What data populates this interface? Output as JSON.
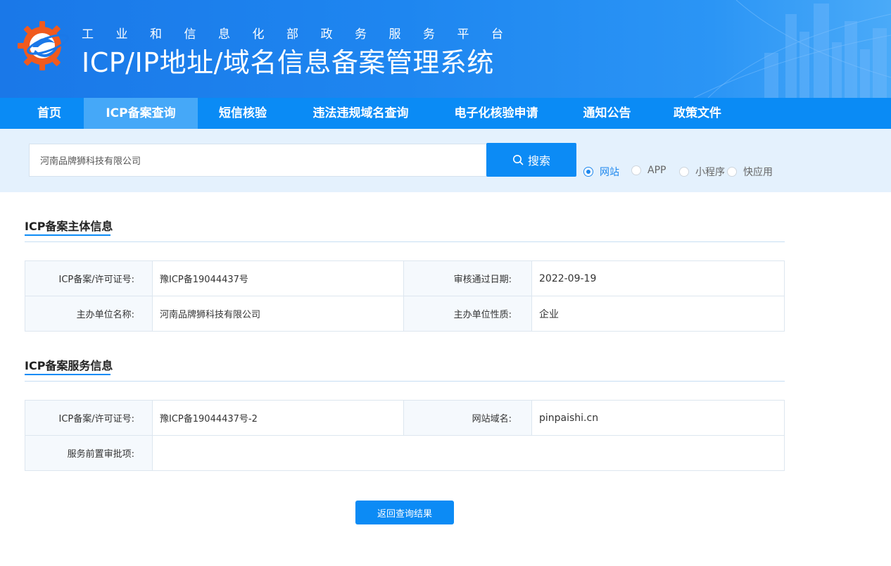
{
  "header": {
    "subtitle": "工业和信息化部政务服务平台",
    "title": "ICP/IP地址/域名信息备案管理系统"
  },
  "nav": {
    "items": [
      {
        "label": "首页"
      },
      {
        "label": "ICP备案查询",
        "active": true
      },
      {
        "label": "短信核验"
      },
      {
        "label": "违法违规域名查询"
      },
      {
        "label": "电子化核验申请"
      },
      {
        "label": "通知公告"
      },
      {
        "label": "政策文件"
      }
    ]
  },
  "search": {
    "value": "河南品牌狮科技有限公司",
    "button_label": "搜索",
    "types": [
      {
        "label": "网站",
        "checked": true
      },
      {
        "label": "APP",
        "checked": false
      },
      {
        "label": "小程序",
        "checked": false
      },
      {
        "label": "快应用",
        "checked": false
      }
    ]
  },
  "subject_section": {
    "title": "ICP备案主体信息",
    "rows": [
      {
        "k1": "ICP备案/许可证号:",
        "v1": "豫ICP备19044437号",
        "k2": "审核通过日期:",
        "v2": "2022-09-19"
      },
      {
        "k1": "主办单位名称:",
        "v1": "河南品牌狮科技有限公司",
        "k2": "主办单位性质:",
        "v2": "企业"
      }
    ]
  },
  "service_section": {
    "title": "ICP备案服务信息",
    "row1": {
      "k1": "ICP备案/许可证号:",
      "v1": "豫ICP备19044437号-2",
      "k2": "网站域名:",
      "v2": "pinpaishi.cn"
    },
    "row2": {
      "k1": "服务前置审批项:",
      "v1": ""
    }
  },
  "back_button": {
    "label": "返回查询结果"
  },
  "colors": {
    "primary": "#0c8bf5",
    "nav_active": "#45a8f8",
    "search_bg": "#e4f1fd",
    "logo_orange": "#f05a1e"
  }
}
